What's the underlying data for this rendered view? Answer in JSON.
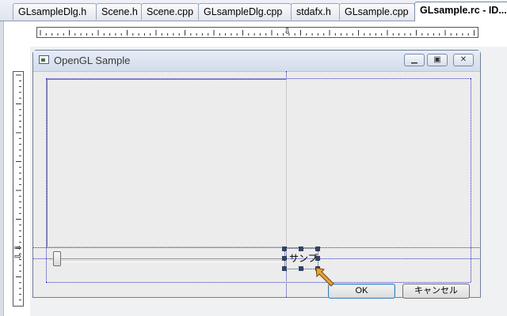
{
  "tabs": [
    {
      "label": "GLsampleDlg.h"
    },
    {
      "label": "Scene.h"
    },
    {
      "label": "Scene.cpp"
    },
    {
      "label": "GLsampleDlg.cpp"
    },
    {
      "label": "stdafx.h"
    },
    {
      "label": "GLsample.cpp"
    },
    {
      "label": "GLsample.rc - ID..."
    }
  ],
  "active_tab": "GLsample.rc - ID...",
  "dialog": {
    "title": "OpenGL Sample",
    "caption_buttons": {
      "minimize": "minimize-icon",
      "restore": "restore-icon",
      "close": "close-icon"
    },
    "static_label": "サンプ",
    "ok_label": "OK",
    "cancel_label": "キャンセル"
  },
  "colors": {
    "guide": "#2e2ebe",
    "selection_handles": "#34435f",
    "cursor": "#f0a030"
  },
  "icons": {
    "ruler_marker": "hollow-arrow-icon",
    "cursor": "resize-cursor-icon"
  }
}
